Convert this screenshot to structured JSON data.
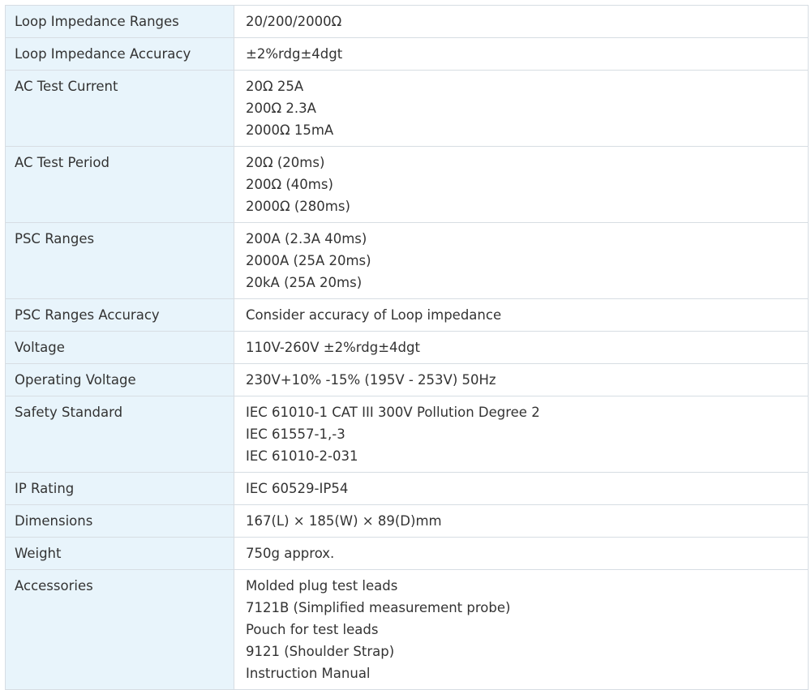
{
  "rows": [
    {
      "label": "Loop Impedance Ranges",
      "values": [
        "20/200/2000Ω"
      ]
    },
    {
      "label": "Loop Impedance Accuracy",
      "values": [
        "±2%rdg±4dgt"
      ]
    },
    {
      "label": "AC Test Current",
      "values": [
        "20Ω 25A",
        "200Ω 2.3A",
        "2000Ω 15mA"
      ]
    },
    {
      "label": "AC Test Period",
      "values": [
        "20Ω (20ms)",
        "200Ω (40ms)",
        "2000Ω (280ms)"
      ]
    },
    {
      "label": "PSC Ranges",
      "values": [
        "200A (2.3A 40ms)",
        "2000A (25A 20ms)",
        "20kA (25A 20ms)"
      ]
    },
    {
      "label": "PSC Ranges Accuracy",
      "values": [
        "Consider accuracy of Loop impedance"
      ]
    },
    {
      "label": "Voltage",
      "values": [
        "110V-260V ±2%rdg±4dgt"
      ]
    },
    {
      "label": "Operating Voltage",
      "values": [
        "230V+10% -15% (195V - 253V) 50Hz"
      ]
    },
    {
      "label": "Safety Standard",
      "values": [
        "IEC 61010-1 CAT III 300V Pollution Degree 2",
        "IEC 61557-1,-3",
        "IEC 61010-2-031"
      ]
    },
    {
      "label": "IP Rating",
      "values": [
        "IEC 60529-IP54"
      ]
    },
    {
      "label": "Dimensions",
      "values": [
        "167(L) × 185(W) × 89(D)mm"
      ]
    },
    {
      "label": "Weight",
      "values": [
        "750g approx."
      ]
    },
    {
      "label": "Accessories",
      "values": [
        "Molded plug test leads",
        "7121B (Simplified measurement probe)",
        "Pouch for test leads",
        "9121 (Shoulder Strap)",
        "Instruction Manual"
      ]
    }
  ]
}
